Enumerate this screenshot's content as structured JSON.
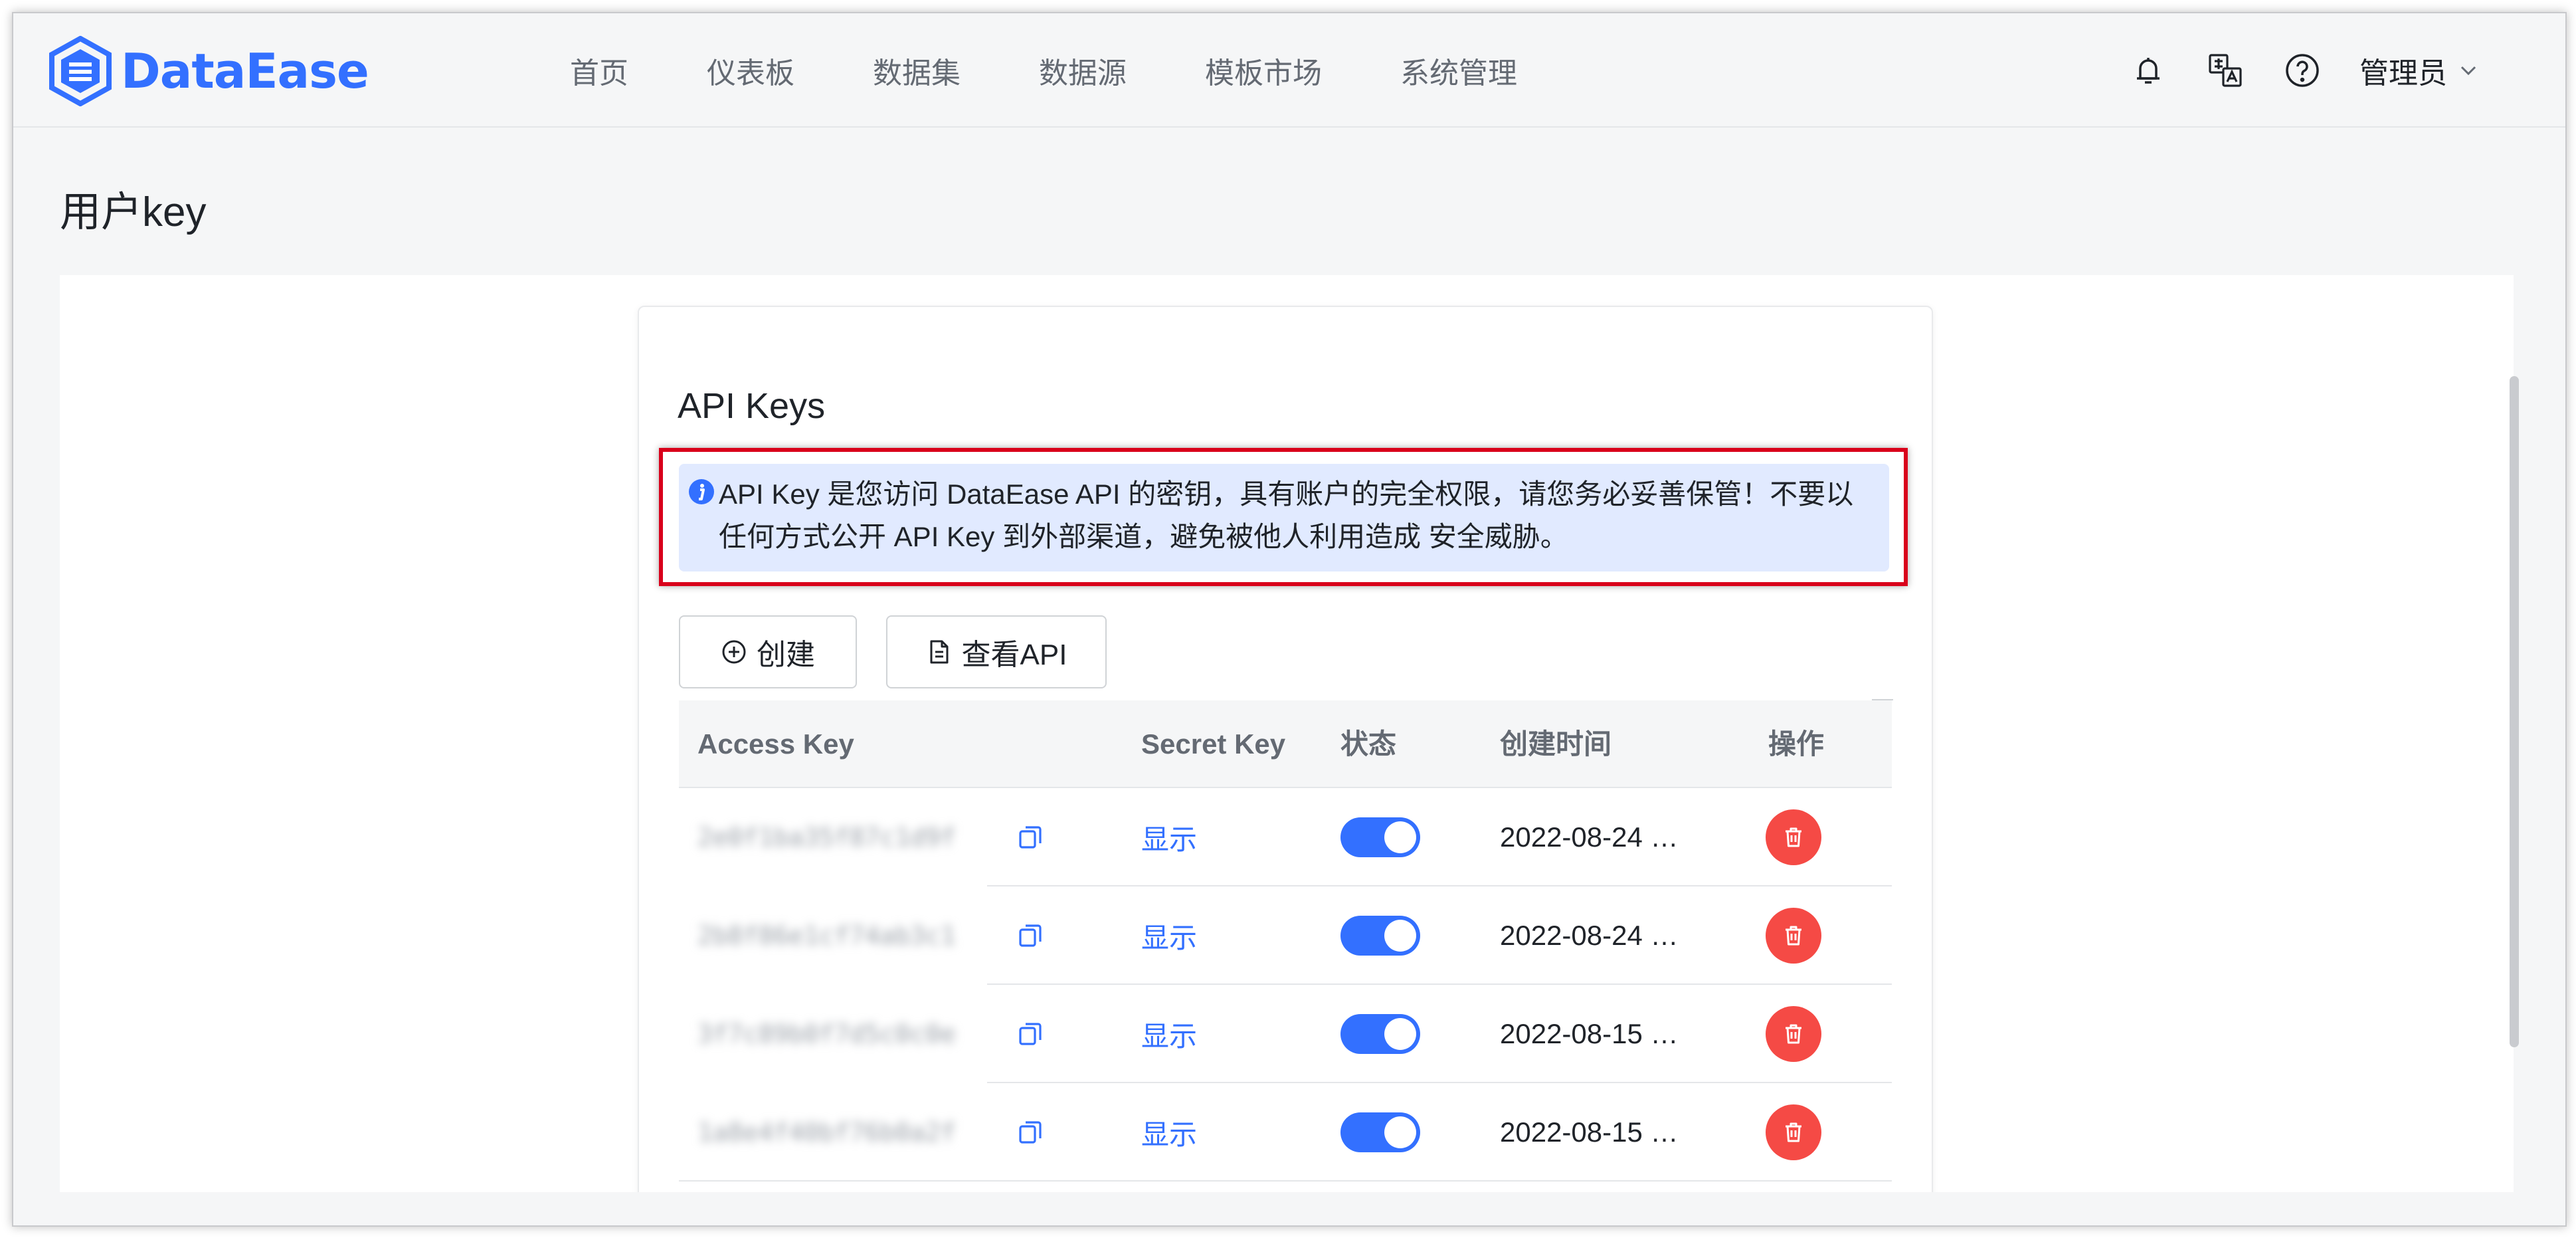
{
  "app": {
    "logo_text": "DataEase"
  },
  "nav": {
    "items": [
      "首页",
      "仪表板",
      "数据集",
      "数据源",
      "模板市场",
      "系统管理"
    ]
  },
  "header": {
    "icons": [
      "bell-icon",
      "translate-icon",
      "help-icon"
    ],
    "user_name": "管理员"
  },
  "page": {
    "title": "用户key"
  },
  "card": {
    "title": "API Keys",
    "alert_text": "API Key 是您访问 DataEase API 的密钥，具有账户的完全权限，请您务必妥善保管！不要以任何方式公开 API Key 到外部渠道，避免被他人利用造成 安全威胁。",
    "buttons": {
      "create": "创建",
      "view_api": "查看API"
    }
  },
  "table": {
    "columns": {
      "access_key": "Access Key",
      "secret_key": "Secret Key",
      "status": "状态",
      "created": "创建时间",
      "action": "操作"
    },
    "rows": [
      {
        "access_key": "2e0f1ba35f87c1d9f",
        "secret_label": "显示",
        "enabled": true,
        "created": "2022-08-24 …"
      },
      {
        "access_key": "2b8f86e1cf74ab3c1",
        "secret_label": "显示",
        "enabled": true,
        "created": "2022-08-24 …"
      },
      {
        "access_key": "3f7c89b0f7d5c0c0e",
        "secret_label": "显示",
        "enabled": true,
        "created": "2022-08-15 …"
      },
      {
        "access_key": "1a8e4f40bf76b0a2f",
        "secret_label": "显示",
        "enabled": true,
        "created": "2022-08-15 …"
      }
    ]
  },
  "colors": {
    "primary": "#3370ff",
    "danger": "#f54a45",
    "highlight_outline": "#d9001b",
    "alert_bg": "#e1eaff"
  }
}
